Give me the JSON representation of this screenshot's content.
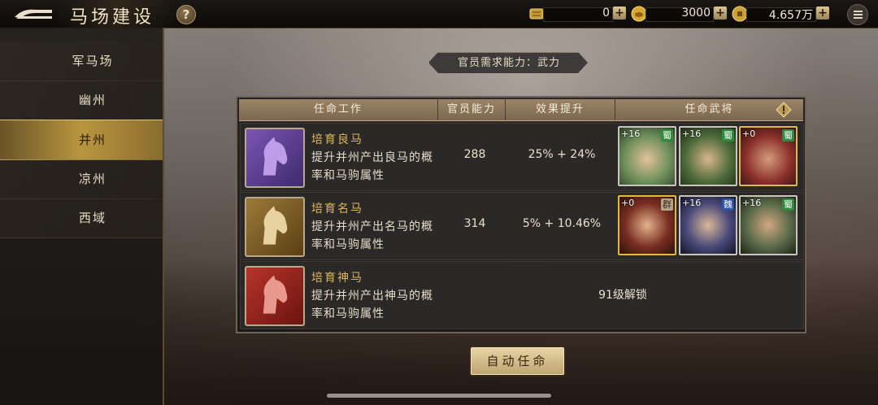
{
  "header": {
    "title": "马场建设",
    "help_label": "?",
    "resources": [
      {
        "icon": "scroll-token-icon",
        "value": "0"
      },
      {
        "icon": "gold-ingot-icon",
        "value": "3000"
      },
      {
        "icon": "copper-coin-icon",
        "value": "4.657万"
      }
    ],
    "plus_label": "+"
  },
  "sidebar": {
    "items": [
      {
        "label": "军马场",
        "active": false
      },
      {
        "label": "幽州",
        "active": false
      },
      {
        "label": "并州",
        "active": true
      },
      {
        "label": "凉州",
        "active": false
      },
      {
        "label": "西域",
        "active": false
      }
    ]
  },
  "requirement": "官员需求能力：武力",
  "table": {
    "headers": [
      "任命工作",
      "官员能力",
      "效果提升",
      "任命武将"
    ],
    "info_icon": "exclamation-icon",
    "rows": [
      {
        "name": "培育良马",
        "desc": "提升并州产出良马的概率和马驹属性",
        "ability": "288",
        "effect": "25% + 24%",
        "icon": "purple-horse-head-icon",
        "generals": [
          {
            "level": "+16",
            "faction": "蜀",
            "faction_type": "shu",
            "frame": "white",
            "skin": "#6e8f5a"
          },
          {
            "level": "+16",
            "faction": "蜀",
            "faction_type": "shu",
            "frame": "white",
            "skin": "#4d6b3a"
          },
          {
            "level": "+0",
            "faction": "蜀",
            "faction_type": "shu",
            "frame": "gold",
            "skin": "#8b2f2a"
          }
        ]
      },
      {
        "name": "培育名马",
        "desc": "提升并州产出名马的概率和马驹属性",
        "ability": "314",
        "effect": "5% + 10.46%",
        "icon": "gold-horse-head-icon",
        "generals": [
          {
            "level": "+0",
            "faction": "群",
            "faction_type": "qun",
            "frame": "gold",
            "skin": "#7a2e22"
          },
          {
            "level": "+16",
            "faction": "魏",
            "faction_type": "wei",
            "frame": "white",
            "skin": "#4a4a7a"
          },
          {
            "level": "+16",
            "faction": "蜀",
            "faction_type": "shu",
            "frame": "white",
            "skin": "#5b6b4a"
          }
        ]
      },
      {
        "name": "培育神马",
        "desc": "提升并州产出神马的概率和马驹属性",
        "icon": "red-horse-head-icon",
        "lock_text": "91级解锁"
      }
    ]
  },
  "auto_button": "自动任命"
}
